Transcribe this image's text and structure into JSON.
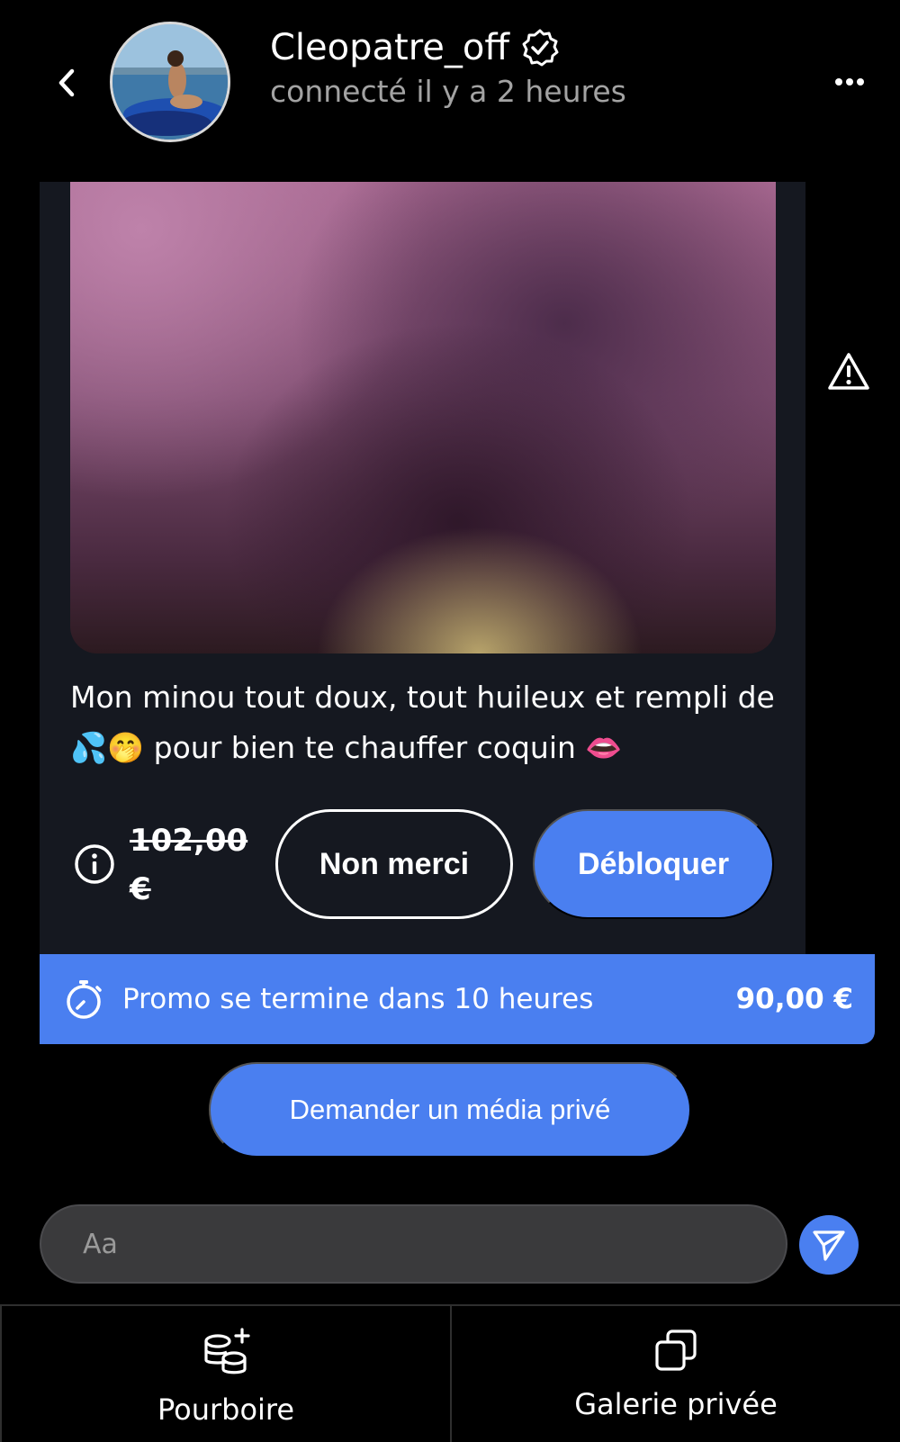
{
  "header": {
    "username": "Cleopatre_off",
    "status": "connecté il y a 2 heures"
  },
  "message": {
    "caption": "Mon minou tout doux, tout huileux et rempli de 💦🤭 pour bien te chauffer coquin 👄",
    "old_price": "102,00 €",
    "decline_label": "Non merci",
    "unlock_label": "Débloquer"
  },
  "promo": {
    "text": "Promo se termine dans 10 heures",
    "price": "90,00 €"
  },
  "request_media_label": "Demander un média privé",
  "composer": {
    "placeholder": "Aa"
  },
  "bottom_tabs": {
    "tip_label": "Pourboire",
    "gallery_label": "Galerie privée"
  },
  "colors": {
    "accent": "#4a7ff0",
    "background": "#000000",
    "card": "#151820"
  },
  "icons": [
    "back-arrow-icon",
    "verified-badge-icon",
    "more-options-icon",
    "warning-icon",
    "info-icon",
    "stopwatch-icon",
    "send-icon",
    "coins-plus-icon",
    "gallery-icon"
  ]
}
